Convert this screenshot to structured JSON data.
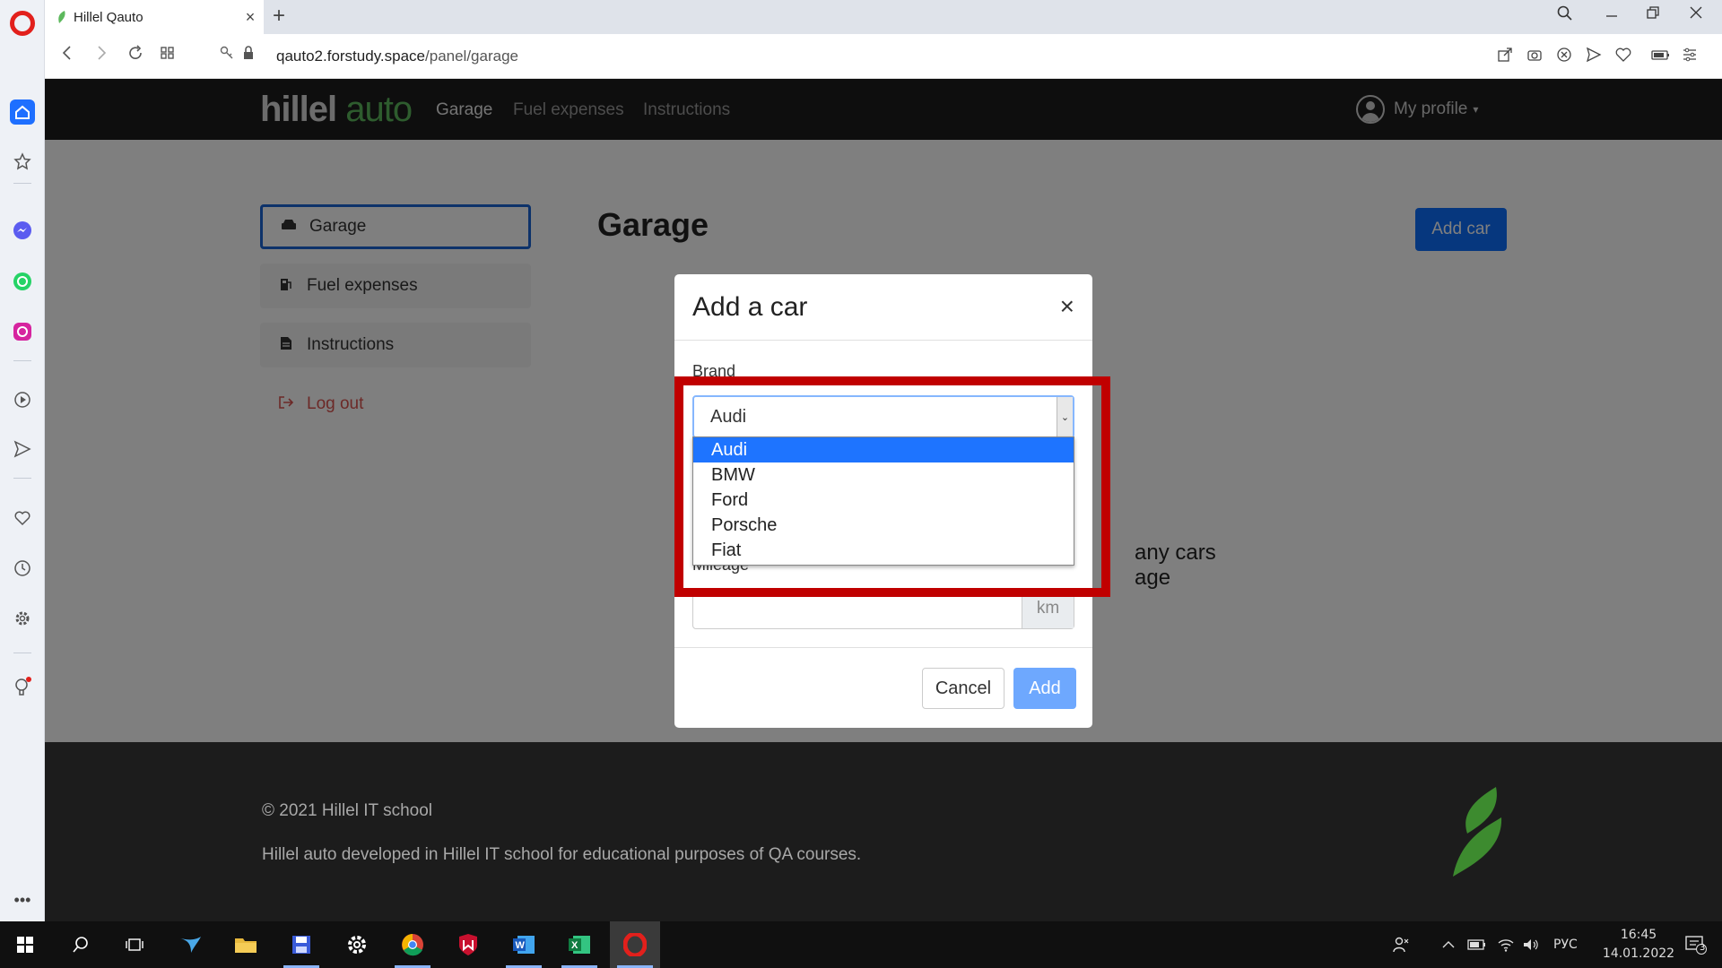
{
  "browser": {
    "tab_title": "Hillel Qauto",
    "tab_close": "×",
    "new_tab": "+",
    "url_host": "qauto2.forstudy.space",
    "url_path": "/panel/garage"
  },
  "site": {
    "logo_part1": "hillel",
    "logo_part2": "auto",
    "nav": [
      "Garage",
      "Fuel expenses",
      "Instructions"
    ],
    "profile_label": "My profile",
    "profile_caret": "▾"
  },
  "sidebar": {
    "items": [
      {
        "label": "Garage",
        "icon": "car-icon"
      },
      {
        "label": "Fuel expenses",
        "icon": "fuel-pump-icon"
      },
      {
        "label": "Instructions",
        "icon": "document-icon"
      },
      {
        "label": "Log out",
        "icon": "logout-icon"
      }
    ]
  },
  "main": {
    "title": "Garage",
    "add_car_label": "Add car",
    "empty_text_line1": "any cars",
    "empty_text_line2": "age"
  },
  "modal": {
    "title": "Add a car",
    "close": "×",
    "brand_label": "Brand",
    "brand_selected": "Audi",
    "brand_options": [
      "Audi",
      "BMW",
      "Ford",
      "Porsche",
      "Fiat"
    ],
    "mileage_label": "Mileage",
    "mileage_value": "",
    "mileage_unit": "km",
    "cancel_label": "Cancel",
    "add_label": "Add"
  },
  "footer": {
    "copyright": "© 2021 Hillel IT school",
    "description": "Hillel auto developed in Hillel IT school for educational purposes of QA courses."
  },
  "taskbar": {
    "lang": "РУС",
    "time": "16:45",
    "date": "14.01.2022",
    "notifications": "3"
  },
  "colors": {
    "primary": "#0d6efd",
    "brand_green": "#5cb85c",
    "highlight_red": "#c00000",
    "logout_red": "#d9534f"
  }
}
